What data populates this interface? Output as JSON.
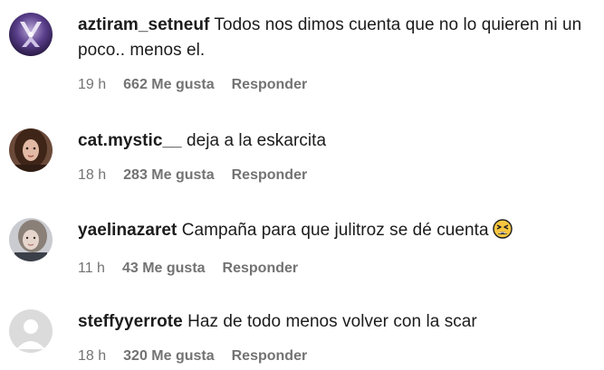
{
  "comments": [
    {
      "username": "aztiram_setneuf",
      "text": "Todos nos dimos cuenta que no lo quieren ni un poco.. menos el.",
      "time": "19 h",
      "likes": "662 Me gusta",
      "reply": "Responder",
      "avatar": "avatar-purple-graphic"
    },
    {
      "username": "cat.mystic__",
      "text": "deja a la eskarcita",
      "time": "18 h",
      "likes": "283 Me gusta",
      "reply": "Responder",
      "avatar": "avatar-photo-person-brown-hair"
    },
    {
      "username": "yaelinazaret",
      "text": "Campaña para que julitroz se dé cuenta",
      "emoji": "tired-face-emoji",
      "time": "11 h",
      "likes": "43 Me gusta",
      "reply": "Responder",
      "avatar": "avatar-photo-person-light-hair"
    },
    {
      "username": "steffyyerrote",
      "text": "Haz de todo menos volver con la scar",
      "time": "18 h",
      "likes": "320 Me gusta",
      "reply": "Responder",
      "avatar": "default-user-icon"
    }
  ],
  "colors": {
    "text": "#1c1c1c",
    "meta": "#737373",
    "default_avatar_bg": "#dbdbdb",
    "default_avatar_fg": "#ffffff"
  }
}
